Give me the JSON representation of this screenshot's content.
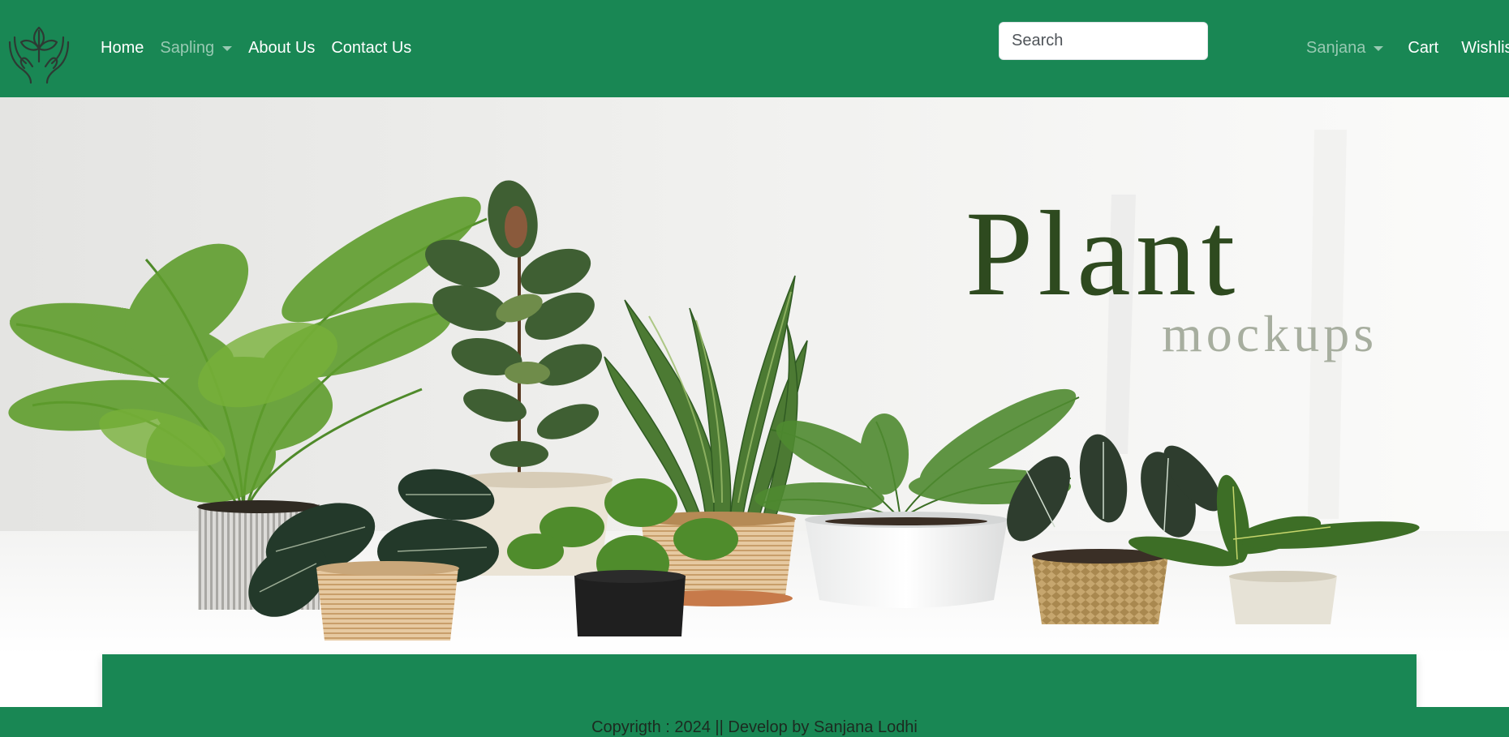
{
  "nav": {
    "links": [
      "Home",
      "Sapling",
      "About Us",
      "Contact Us"
    ],
    "search_placeholder": "Search",
    "user": "Sanjana",
    "cart": "Cart",
    "wishlist": "Wishlist"
  },
  "hero": {
    "title": "Plant",
    "subtitle": "mockups"
  },
  "footer": {
    "copyright": "Copyrigth : 2024 || Develop by Sanjana Lodhi"
  },
  "colors": {
    "brand": "#198754",
    "hero_title": "#2e4a1f",
    "hero_subtitle": "#a7ae9f"
  },
  "icons": [
    "plant-hands-logo-icon",
    "dropdown-caret-icon"
  ]
}
